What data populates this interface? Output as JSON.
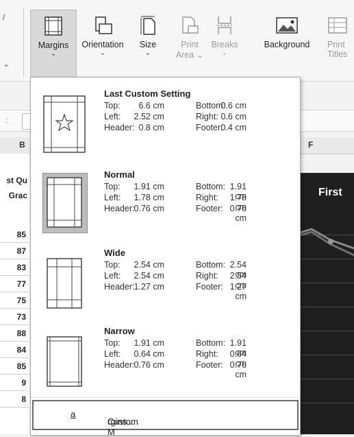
{
  "ribbon": {
    "buttons": [
      {
        "label": "Margins",
        "chevron": "⌄",
        "state": "active"
      },
      {
        "label": "Orientation",
        "chevron": "⌄"
      },
      {
        "label": "Size",
        "chevron": "⌄"
      },
      {
        "label": "Print",
        "label2": "Area",
        "chevron": "⌄",
        "state": "disabled"
      },
      {
        "label": "Breaks",
        "chevron": "⌄",
        "state": "disabled"
      },
      {
        "label": "Background"
      },
      {
        "label": "Print",
        "label2": "Titles",
        "state": "disabled"
      }
    ],
    "icons": [
      "margins-icon",
      "orientation-icon",
      "size-icon",
      "print-area-icon",
      "breaks-icon",
      "background-icon",
      "print-titles-icon"
    ]
  },
  "sheet": {
    "columns": [
      "B",
      "F"
    ],
    "header_cell": [
      "st Qu",
      "Grac"
    ],
    "row_values": [
      "85",
      "87",
      "83",
      "77",
      "75",
      "73",
      "88",
      "84",
      "85",
      "9",
      "8"
    ],
    "chart_title": "First"
  },
  "margins_menu": {
    "options": [
      {
        "name": "Last Custom Setting",
        "top_label": "Top:",
        "top": "6.6 cm",
        "bottom_label": "Bottom:",
        "bottom": "0.6 cm",
        "left_label": "Left:",
        "left": "2.52 cm",
        "right_label": "Right:",
        "right": "0.6 cm",
        "header_label": "Header:",
        "header": "0.8 cm",
        "footer_label": "Footer:",
        "footer": "0.4 cm",
        "icon": "star-icon"
      },
      {
        "name": "Normal",
        "top_label": "Top:",
        "top": "1.91 cm",
        "bottom_label": "Bottom:",
        "bottom": "1.91 cm",
        "left_label": "Left:",
        "left": "1.78 cm",
        "right_label": "Right:",
        "right": "1.78 cm",
        "header_label": "Header:",
        "header": "0.76 cm",
        "footer_label": "Footer:",
        "footer": "0.76 cm",
        "selected": true
      },
      {
        "name": "Wide",
        "top_label": "Top:",
        "top": "2.54 cm",
        "bottom_label": "Bottom:",
        "bottom": "2.54 cm",
        "left_label": "Left:",
        "left": "2.54 cm",
        "right_label": "Right:",
        "right": "2.54 cm",
        "header_label": "Header:",
        "header": "1.27 cm",
        "footer_label": "Footer:",
        "footer": "1.27 cm"
      },
      {
        "name": "Narrow",
        "top_label": "Top:",
        "top": "1.91 cm",
        "bottom_label": "Bottom:",
        "bottom": "1.91 cm",
        "left_label": "Left:",
        "left": "0.64 cm",
        "right_label": "Right:",
        "right": "0.64 cm",
        "header_label": "Header:",
        "header": "0.76 cm",
        "footer_label": "Footer:",
        "footer": "0.76 cm"
      }
    ],
    "custom_label_pre": "Custom M",
    "custom_label_underline": "a",
    "custom_label_post": "rgins..."
  },
  "colors": {
    "selected_thumb": "#bdbdbd",
    "active_button": "#d9d9d9",
    "chart_bg": "#1f1f1f"
  }
}
